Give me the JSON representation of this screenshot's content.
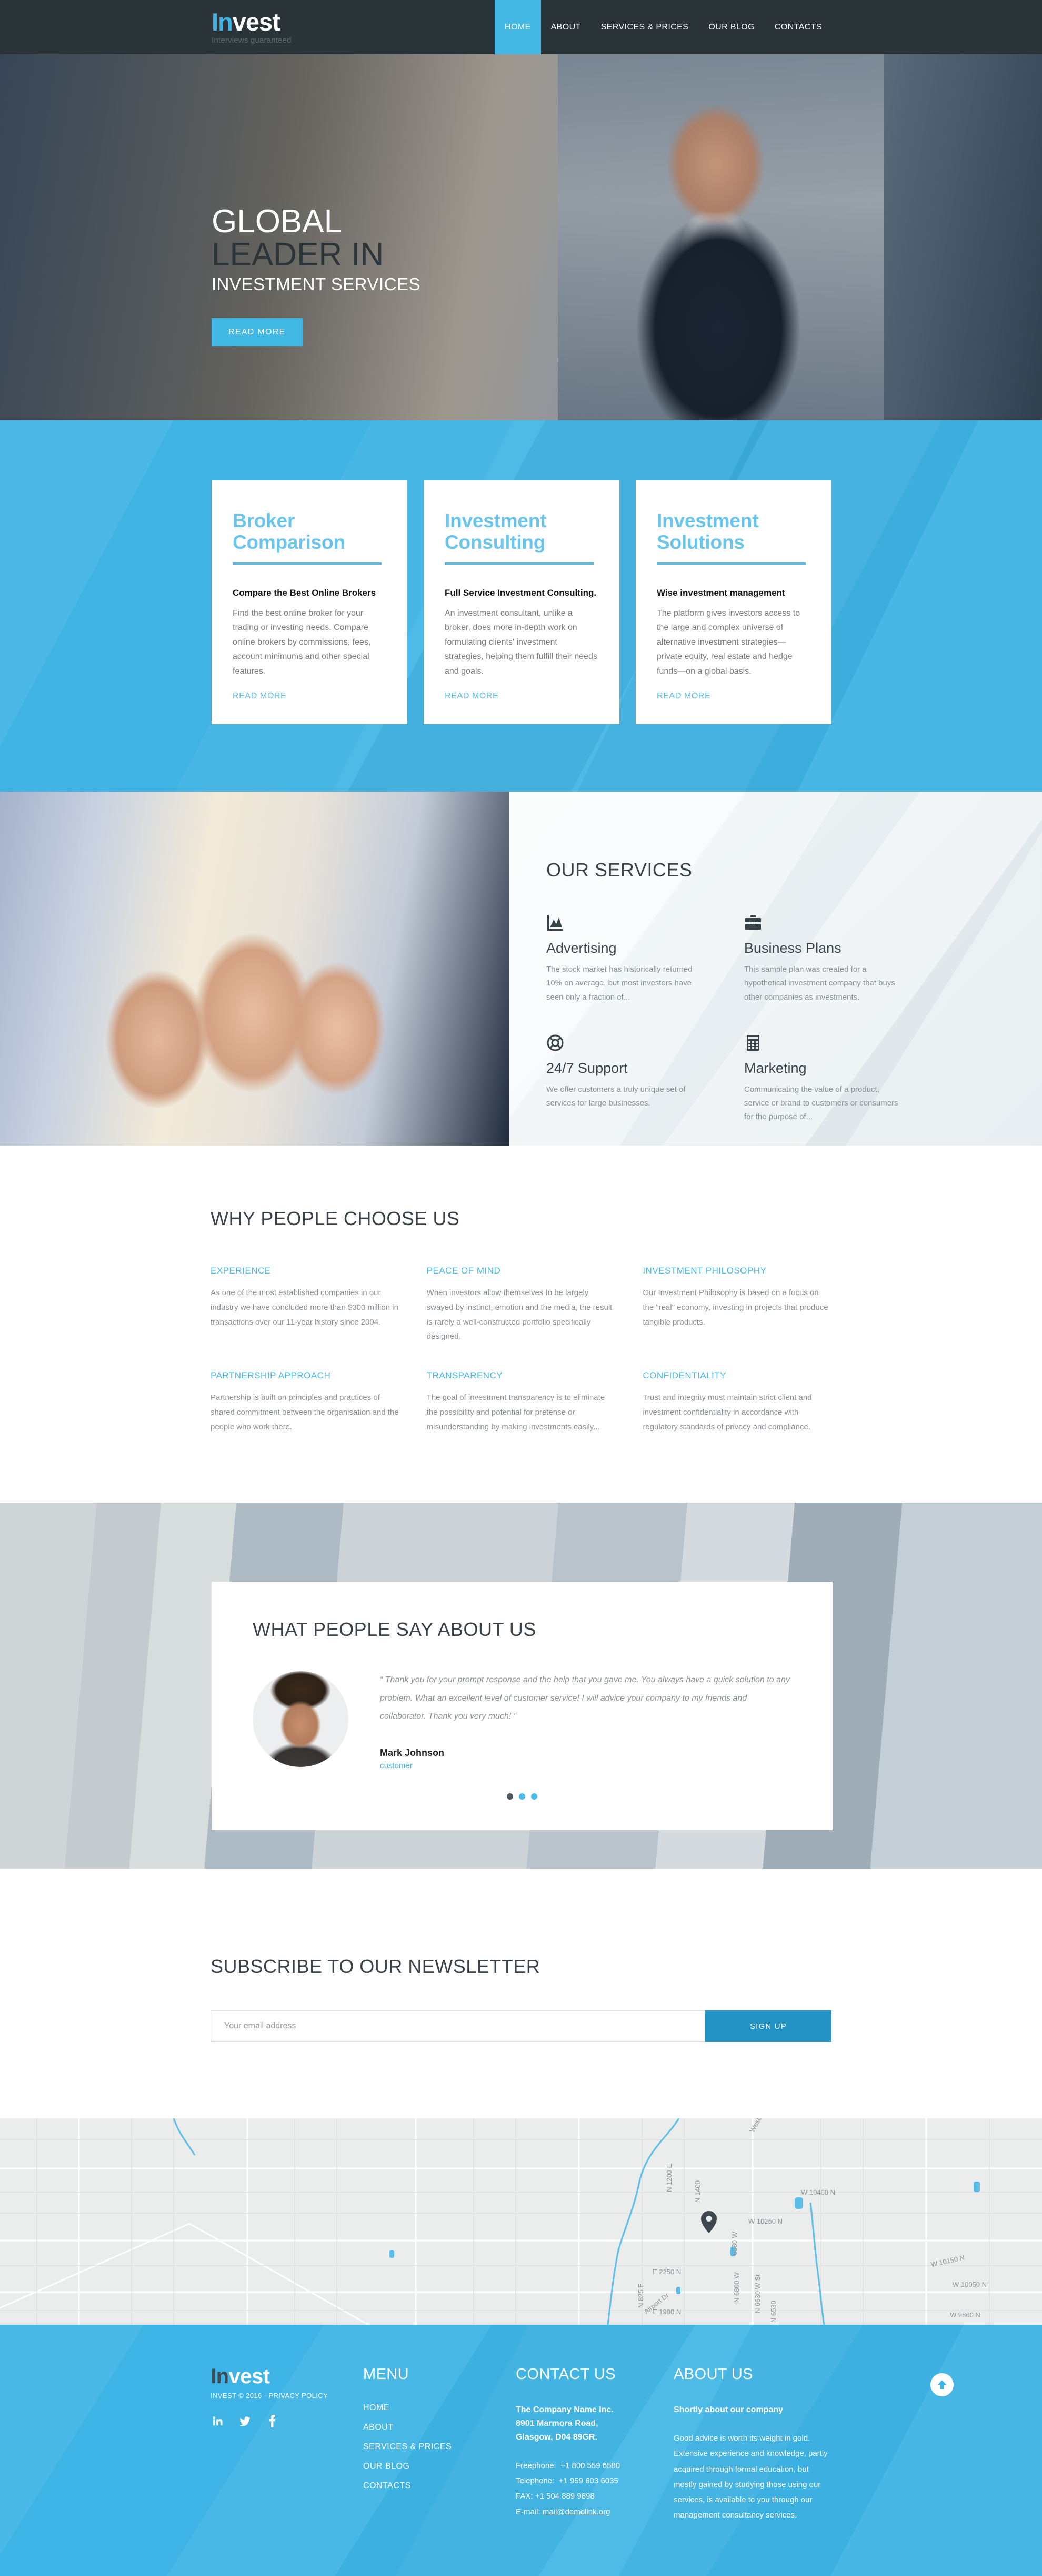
{
  "brand": {
    "name_first": "In",
    "name_rest": "vest",
    "tagline": "Interviews guaranteed",
    "accent": "#42b8e4",
    "dark": "#2b3539"
  },
  "nav": {
    "items": [
      {
        "label": "HOME",
        "active": true
      },
      {
        "label": "ABOUT",
        "active": false
      },
      {
        "label": "SERVICES & PRICES",
        "active": false
      },
      {
        "label": "OUR BLOG",
        "active": false
      },
      {
        "label": "CONTACTS",
        "active": false
      }
    ]
  },
  "hero": {
    "line1": "GLOBAL",
    "line2": "LEADER IN",
    "line3": "INVESTMENT SERVICES",
    "button": "READ MORE",
    "prev_icon": "chevron-left-icon",
    "next_icon": "chevron-right-icon"
  },
  "cards": [
    {
      "title": "Broker Comparison",
      "subtitle": "Compare the Best Online Brokers",
      "body": "Find the best online broker for your trading or investing needs. Compare online brokers by commissions, fees, account minimums and other special features.",
      "link": "READ MORE"
    },
    {
      "title": "Investment Consulting",
      "subtitle": "Full Service Investment Consulting.",
      "body": "An investment consultant, unlike a broker, does more in-depth work on formulating clients' investment strategies, helping them fulfill their needs and goals.",
      "link": "READ MORE"
    },
    {
      "title": "Investment Solutions",
      "subtitle": "Wise investment management",
      "body": "The platform gives investors access to the large and complex universe of alternative investment strategies—private equity, real estate and hedge funds—on a global basis.",
      "link": "READ MORE"
    }
  ],
  "services": {
    "title": "OUR SERVICES",
    "items": [
      {
        "icon": "area-chart-icon",
        "name": "Advertising",
        "text": "The stock market has historically returned 10% on average, but most investors have seen only a fraction of..."
      },
      {
        "icon": "briefcase-icon",
        "name": "Business Plans",
        "text": "This sample plan was created for a hypothetical investment company that buys other companies as investments."
      },
      {
        "icon": "lifebuoy-icon",
        "name": "24/7 Support",
        "text": "We offer customers a truly unique set of services for large businesses."
      },
      {
        "icon": "calculator-icon",
        "name": "Marketing",
        "text": "Communicating the value of a product, service or brand to customers or consumers for the purpose of..."
      }
    ]
  },
  "why": {
    "title": "WHY PEOPLE CHOOSE US",
    "items": [
      {
        "heading": "EXPERIENCE",
        "text": "As one of the most established companies in our industry we have concluded more than $300 million in transactions over our 11-year history since 2004."
      },
      {
        "heading": "PEACE OF MIND",
        "text": "When investors allow themselves to be largely swayed by instinct, emotion and the media, the result is rarely a well-constructed portfolio specifically designed."
      },
      {
        "heading": "INVESTMENT PHILOSOPHY",
        "text": "Our Investment Philosophy is based on a focus on the \"real\" economy, investing in projects that produce tangible products."
      },
      {
        "heading": "PARTNERSHIP APPROACH",
        "text": "Partnership is built on principles and practices of shared commitment between the organisation and the people who work there."
      },
      {
        "heading": "TRANSPARENCY",
        "text": "The goal of investment transparency is to eliminate the possibility and potential for pretense or misunderstanding by making investments easily..."
      },
      {
        "heading": "CONFIDENTIALITY",
        "text": "Trust and integrity must maintain strict client and investment confidentiality in accordance with regulatory standards of privacy and compliance."
      }
    ]
  },
  "testimonials": {
    "title": "WHAT PEOPLE SAY ABOUT US",
    "quote": "“ Thank you for your prompt response and the help that you gave me. You always have a quick solution to any problem. What an excellent level of customer service! I will advice your company to my friends and collaborator. Thank you very much! ”",
    "author": "Mark Johnson",
    "role": "customer",
    "dots": 3,
    "active_dot": 0
  },
  "newsletter": {
    "title": "SUBSCRIBE TO OUR NEWSLETTER",
    "placeholder": "Your email address",
    "value": "",
    "button": "SIGN UP"
  },
  "map": {
    "pin_icon": "map-pin-icon",
    "labels": [
      "W 10400 N",
      "W 10250 N",
      "W 10150 N",
      "W 10050 N",
      "W 9860 N",
      "E 2250 N",
      "E 1900 N",
      "N 1200 E",
      "N 825 E",
      "N 1400 E",
      "N 6800 W",
      "N 6630 W St",
      "N 6530",
      "6580 W",
      "Airport Dr",
      "Westbury Ln"
    ]
  },
  "footer": {
    "logo_first": "In",
    "logo_rest": "vest",
    "copyright": "INVEST © 2016 · PRIVACY POLICY",
    "socials": [
      {
        "icon": "linkedin-icon",
        "label": "in"
      },
      {
        "icon": "twitter-icon",
        "label": "t"
      },
      {
        "icon": "facebook-icon",
        "label": "f"
      }
    ],
    "menu": {
      "title": "MENU",
      "links": [
        "HOME",
        "ABOUT",
        "SERVICES & PRICES",
        "OUR BLOG",
        "CONTACTS"
      ]
    },
    "contact": {
      "title": "CONTACT US",
      "company": "The Company Name Inc.",
      "address1": "8901 Marmora Road,",
      "address2": "Glasgow, D04 89GR.",
      "freephone_label": "Freephone:",
      "freephone": "+1 800 559 6580",
      "telephone_label": "Telephone:",
      "telephone": "+1 959 603 6035",
      "fax_label": "FAX:",
      "fax": "+1 504 889 9898",
      "email_label": "E-mail:",
      "email": "mail@demolink.org"
    },
    "about": {
      "title": "ABOUT US",
      "subtitle": "Shortly about our company",
      "text": "Good advice is worth its weight in gold. Extensive experience and knowledge, partly acquired through formal education, but mostly gained by studying those using our services, is available to you through our management consultancy services."
    },
    "to_top_icon": "arrow-up-circle-icon"
  }
}
